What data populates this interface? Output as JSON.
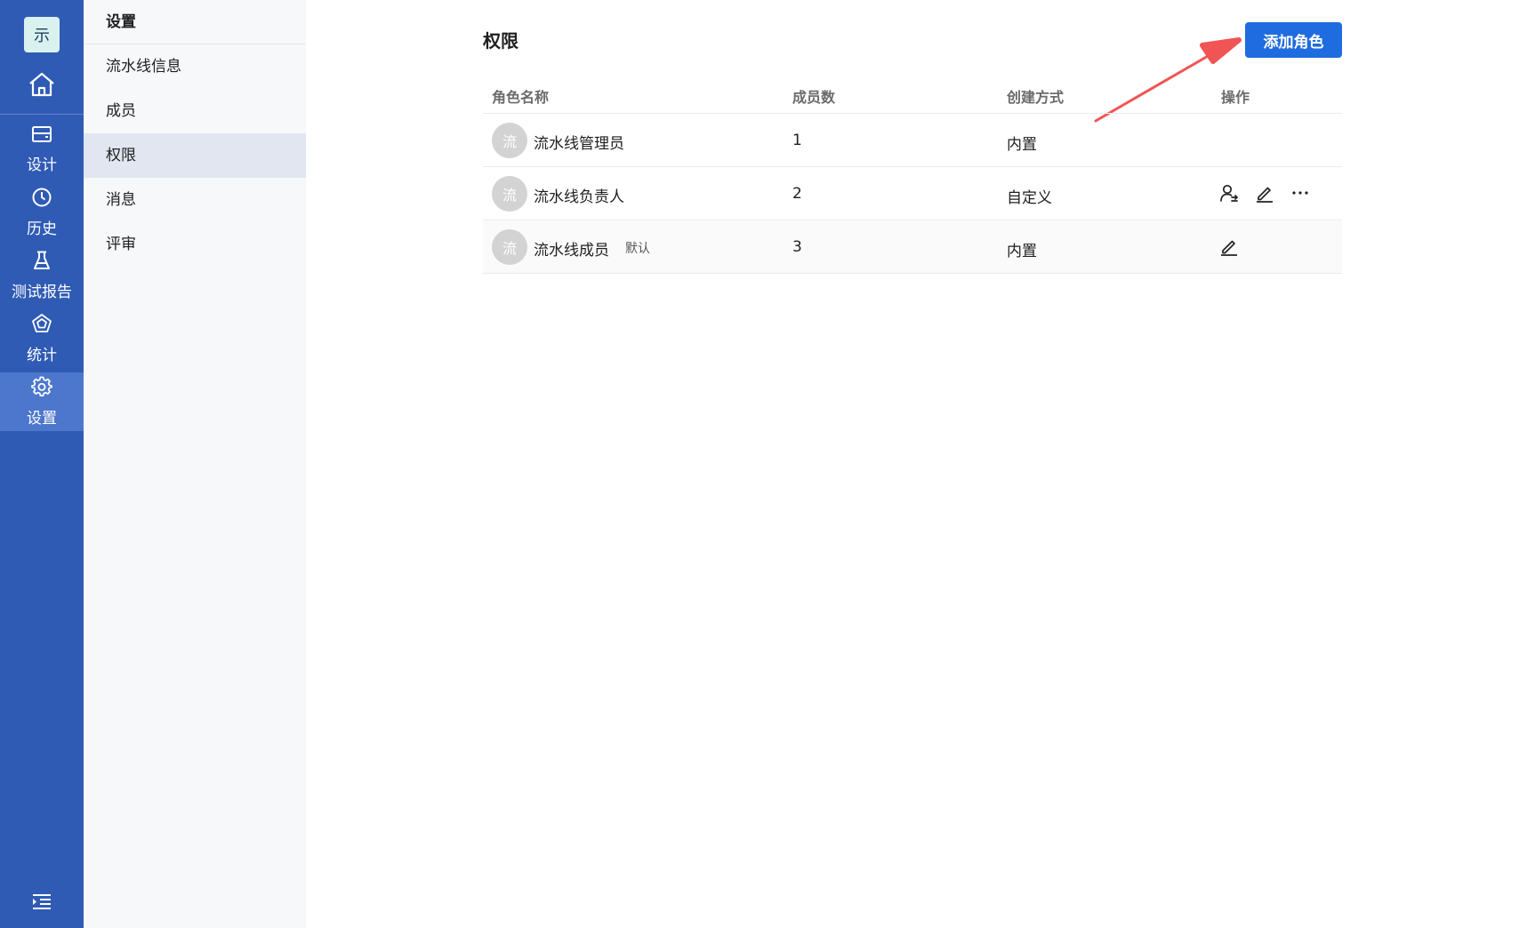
{
  "app": {
    "logo_text": "示",
    "rail": {
      "home_icon": "home-icon",
      "items": [
        {
          "label": "设计",
          "icon": "design-icon"
        },
        {
          "label": "历史",
          "icon": "clock-icon"
        },
        {
          "label": "测试报告",
          "icon": "flask-icon"
        },
        {
          "label": "统计",
          "icon": "pentagon-chart-icon"
        },
        {
          "label": "设置",
          "icon": "gear-icon",
          "active": true
        }
      ],
      "bottom_icon": "collapse-menu-icon"
    },
    "colors": {
      "rail": "#2f5bb5",
      "rail_active": "#4d77cc",
      "primary": "#1f6ce0",
      "annotation_arrow": "#f05454"
    }
  },
  "subnav": {
    "title": "设置",
    "items": [
      {
        "label": "流水线信息"
      },
      {
        "label": "成员"
      },
      {
        "label": "权限",
        "active": true
      },
      {
        "label": "消息"
      },
      {
        "label": "评审"
      }
    ]
  },
  "main": {
    "title": "权限",
    "add_button": "添加角色",
    "table": {
      "headers": {
        "name": "角色名称",
        "members": "成员数",
        "creation": "创建方式",
        "actions": "操作"
      },
      "rows": [
        {
          "avatar": "流",
          "name": "流水线管理员",
          "tag": "",
          "members": "1",
          "creation": "内置",
          "actions": []
        },
        {
          "avatar": "流",
          "name": "流水线负责人",
          "tag": "",
          "members": "2",
          "creation": "自定义",
          "actions": [
            "user-switch-icon",
            "edit-icon",
            "more-icon"
          ]
        },
        {
          "avatar": "流",
          "name": "流水线成员",
          "tag": "默认",
          "members": "3",
          "creation": "内置",
          "actions": [
            "edit-icon"
          ]
        }
      ]
    }
  }
}
